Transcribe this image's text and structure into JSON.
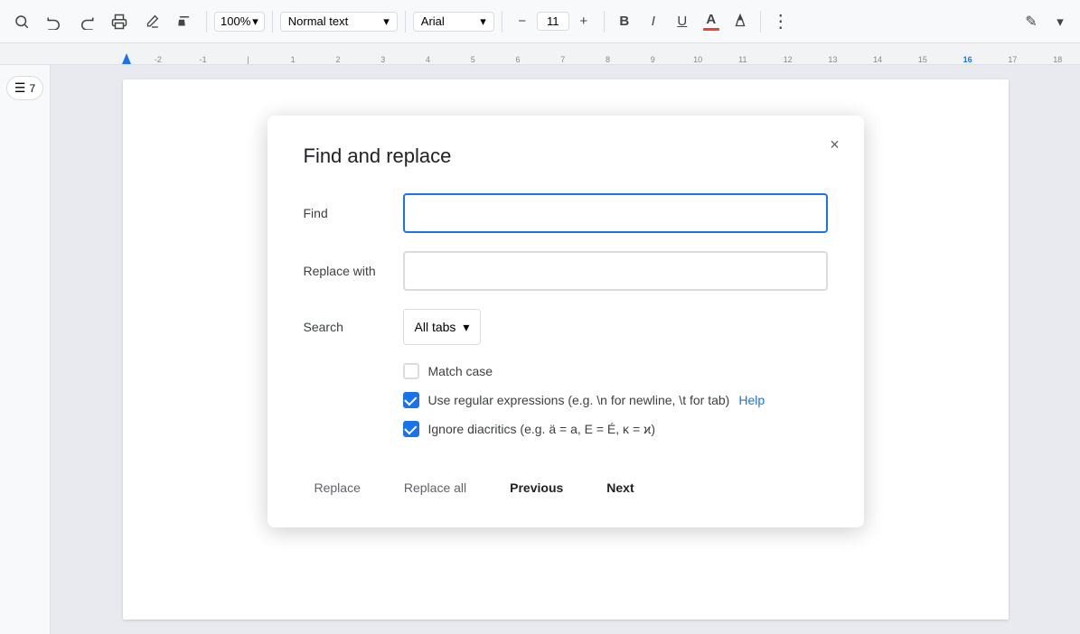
{
  "toolbar": {
    "zoom": "100%",
    "style": "Normal text",
    "font": "Arial",
    "fontSize": "11",
    "bold": "B",
    "italic": "I",
    "underline": "U",
    "moreOptions": "⋮",
    "editIcon": "✎"
  },
  "sidebar": {
    "listIcon": "☰",
    "pageCount": "7"
  },
  "ruler": {
    "marks": [
      "-2",
      "-1",
      "1",
      "2",
      "3",
      "4",
      "5",
      "6",
      "7",
      "8",
      "9",
      "10",
      "11",
      "12",
      "13",
      "14",
      "15",
      "16",
      "17",
      "18"
    ]
  },
  "dialog": {
    "title": "Find and replace",
    "closeLabel": "×",
    "findLabel": "Find",
    "findPlaceholder": "",
    "replaceLabel": "Replace with",
    "replacePlaceholder": "",
    "searchLabel": "Search",
    "searchValue": "All tabs",
    "searchDropIcon": "▾",
    "matchCaseLabel": "Match case",
    "matchCaseChecked": false,
    "regexLabel": "Use regular expressions (e.g. \\n for newline, \\t for tab)",
    "regexHelpLink": "Help",
    "regexChecked": true,
    "diacriticsLabel": "Ignore diacritics (e.g. ä = a, E = É, κ = ϰ)",
    "diacriticsChecked": true,
    "replaceBtn": "Replace",
    "replaceAllBtn": "Replace all",
    "previousBtn": "Previous",
    "nextBtn": "Next"
  }
}
